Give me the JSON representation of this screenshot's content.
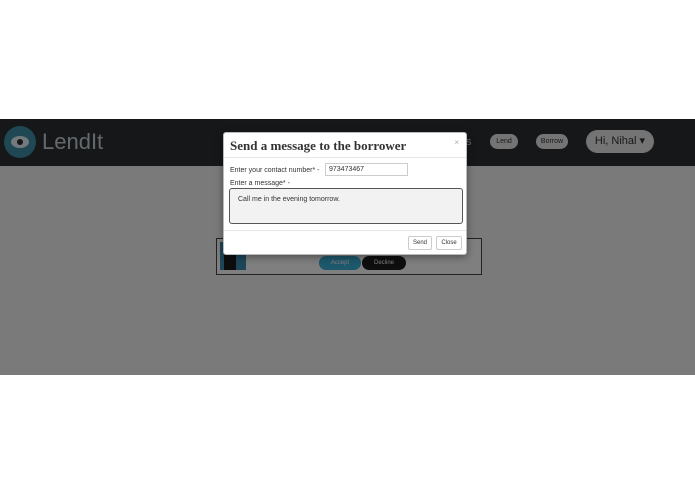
{
  "navbar": {
    "brand": "LendIt",
    "hidden_link": "s",
    "lend_label": "Lend",
    "borrow_label": "Borrow",
    "user_menu": "Hi, Nihal ▾"
  },
  "request_card": {
    "accept_label": "Accept",
    "decline_label": "Decline"
  },
  "modal": {
    "title": "Send a message to the borrower",
    "close_x": "×",
    "contact_label": "Enter your contact number* -",
    "contact_value": "973473467",
    "message_label": "Enter a message* -",
    "message_value": "Call me in the evening tomorrow.",
    "send_label": "Send",
    "close_label": "Close"
  },
  "colors": {
    "navbar_bg": "#2a2e33",
    "accent": "#3ab0d8",
    "overlay": "rgba(0,0,0,0.5)"
  },
  "icons": {
    "logo": "eye-logo-icon",
    "caret": "chevron-down-icon"
  }
}
